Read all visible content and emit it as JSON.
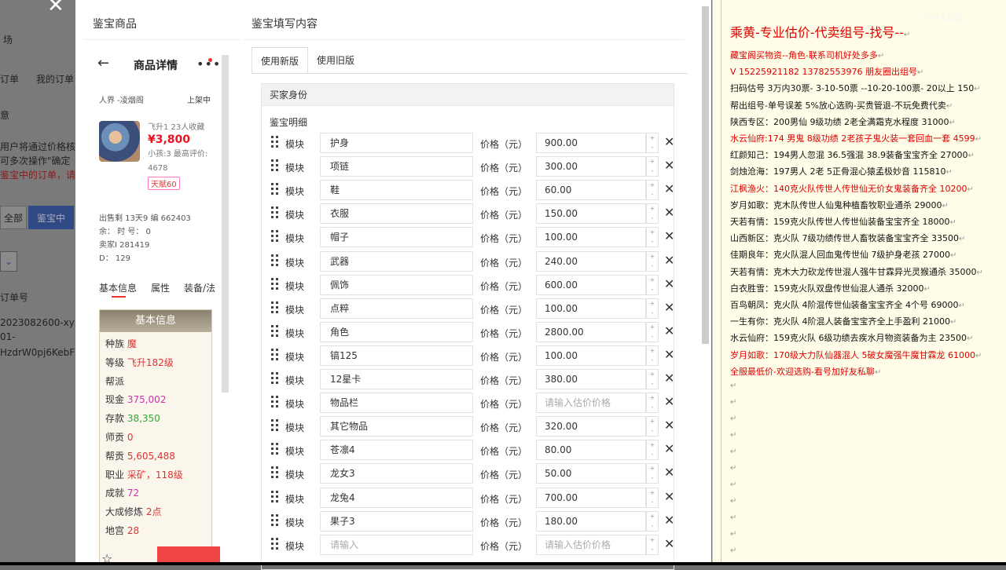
{
  "background_page": {
    "texts": [
      "场",
      "订单",
      "我的订单",
      "意",
      "用户将通过价格核",
      "可多次操作\"确定",
      "鉴宝中的订单，请",
      "全部",
      "鉴宝中",
      "订单号",
      "2023082600-xy2-",
      "01-",
      "HzdrW0pj6KebF"
    ]
  },
  "modal": {
    "left_title": "鉴宝商品",
    "right_title": "鉴宝填写内容"
  },
  "phone": {
    "header_title": "商品详情",
    "server": "人界 -凌烟阁",
    "status": "上架中",
    "info_line1": "飞升1 23人收藏",
    "price": "¥3,800",
    "info_line2": "小孩:3  最高评价:",
    "info_line3": "4678",
    "tag": "天赋60",
    "stats": [
      "出售剩 13天9    编 662403",
      "余：  时        号：     0",
      "卖家I  281419",
      "D：    129"
    ],
    "tabs": [
      "基本信息",
      "属性",
      "装备/法"
    ],
    "card_title": "基本信息",
    "attributes": [
      {
        "k": "种族",
        "v": "魔",
        "c": "v"
      },
      {
        "k": "等级",
        "v": "飞升182级",
        "c": "v"
      },
      {
        "k": "帮派",
        "v": "",
        "c": "v"
      },
      {
        "k": "现金",
        "v": "375,002",
        "c": "vp"
      },
      {
        "k": "存款",
        "v": "38,350",
        "c": "vg"
      },
      {
        "k": "师贡",
        "v": "0",
        "c": "v"
      },
      {
        "k": "帮贡",
        "v": "5,605,488",
        "c": "v"
      },
      {
        "k": "职业",
        "v": "采矿，118级",
        "c": "v"
      },
      {
        "k": "成就",
        "v": "72",
        "c": "vp"
      },
      {
        "k": "大成修炼",
        "v": "2点",
        "c": "v"
      },
      {
        "k": "地宫",
        "v": "28",
        "c": "v"
      }
    ]
  },
  "form": {
    "tabs": [
      "使用新版",
      "使用旧版"
    ],
    "panel_header": "买家身份",
    "sub_header": "鉴宝明细",
    "module_label": "模块",
    "price_label": "价格（元）",
    "placeholder_module": "请输入",
    "placeholder_price": "请输入估价价格",
    "rows": [
      {
        "name": "护身",
        "price": "900.00"
      },
      {
        "name": "项链",
        "price": "300.00"
      },
      {
        "name": "鞋",
        "price": "60.00"
      },
      {
        "name": "衣服",
        "price": "150.00"
      },
      {
        "name": "帽子",
        "price": "100.00"
      },
      {
        "name": "武器",
        "price": "240.00"
      },
      {
        "name": "佩饰",
        "price": "600.00"
      },
      {
        "name": "点粹",
        "price": "100.00"
      },
      {
        "name": "角色",
        "price": "2800.00"
      },
      {
        "name": "镐125",
        "price": "100.00"
      },
      {
        "name": "12星卡",
        "price": "380.00"
      },
      {
        "name": "物品栏",
        "price": ""
      },
      {
        "name": "其它物品",
        "price": "320.00"
      },
      {
        "name": "苍凛4",
        "price": "80.00"
      },
      {
        "name": "龙女3",
        "price": "50.00"
      },
      {
        "name": "龙兔4",
        "price": "700.00"
      },
      {
        "name": "果子3",
        "price": "180.00"
      },
      {
        "name": "",
        "price": ""
      }
    ]
  },
  "note": {
    "lines": [
      {
        "t": "乘黄-专业估价-代卖组号-找号--",
        "cls": "title"
      },
      {
        "t": "藏宝阁买物资--角色-联系司机好处多多",
        "cls": "red"
      },
      {
        "t": "V 15225921182   13782553976 朋友圈出组号",
        "cls": "red"
      },
      {
        "t": "扫码估号 3万内30票- 3-10-50票  --10-20-100票- 20以上 150",
        "cls": ""
      },
      {
        "t": "帮出组号-单号误差 5%放心选购-买贵管退-不玩免费代卖",
        "cls": ""
      },
      {
        "t": "陕西专区：200男仙 9级功绩 2老全满霜克水程度 31000",
        "cls": ""
      },
      {
        "t": "水云仙府:174 男鬼 8级功绩 2老孩子鬼火装一套回血一套 4599",
        "cls": "red"
      },
      {
        "t": "红颜知己：194男人忽混 36.5强混 38.9装备宝宝齐全 27000",
        "cls": ""
      },
      {
        "t": "剑烛沧海：197男人 2老 5正骨混心猿孟极妙音 115810",
        "cls": ""
      },
      {
        "t": "江枫渔火：140克火队传世人传世仙无价女鬼装备齐全 10200",
        "cls": "red"
      },
      {
        "t": "岁月如歌：克木队传世人仙鬼种植畜牧职业通杀 29000",
        "cls": ""
      },
      {
        "t": "天若有情：159克火队传世人传世仙装备宝宝齐全 18000",
        "cls": ""
      },
      {
        "t": "山西新区：克火队 7级功绩传世人畜牧装备宝宝齐全 33500",
        "cls": ""
      },
      {
        "t": "佳期良年：克火队混人回血鬼传世仙 7级护身老孩 27000",
        "cls": ""
      },
      {
        "t": "天若有情：克木大力砍龙传世混人强牛甘霖异光灵猴通杀 35000",
        "cls": ""
      },
      {
        "t": "白衣胜雪：159克火队双盘传世仙混人通杀 32000",
        "cls": ""
      },
      {
        "t": "百鸟朝凤：克火队 4阶混传世仙装备宝宝齐全 4个号 69000",
        "cls": ""
      },
      {
        "t": "一生有你：克火队 4阶混人装备宝宝齐全上手盈利 21000",
        "cls": ""
      },
      {
        "t": "水云仙府：159克火队 6级功绩去疾水月物资装备为主 23500",
        "cls": ""
      },
      {
        "t": "岁月如歌：170级大力队仙器混人 5破女魔强牛魔甘霖龙 61000",
        "cls": "red"
      },
      {
        "t": "全服最低价-欢迎选购-看号加好友私聊",
        "cls": "red"
      }
    ],
    "ret_mark": "↵",
    "logo": "©XX游戏"
  },
  "colors": {
    "accent_red": "#e33",
    "link_blue": "#2f4a84",
    "note_bg": "#fffde8"
  }
}
